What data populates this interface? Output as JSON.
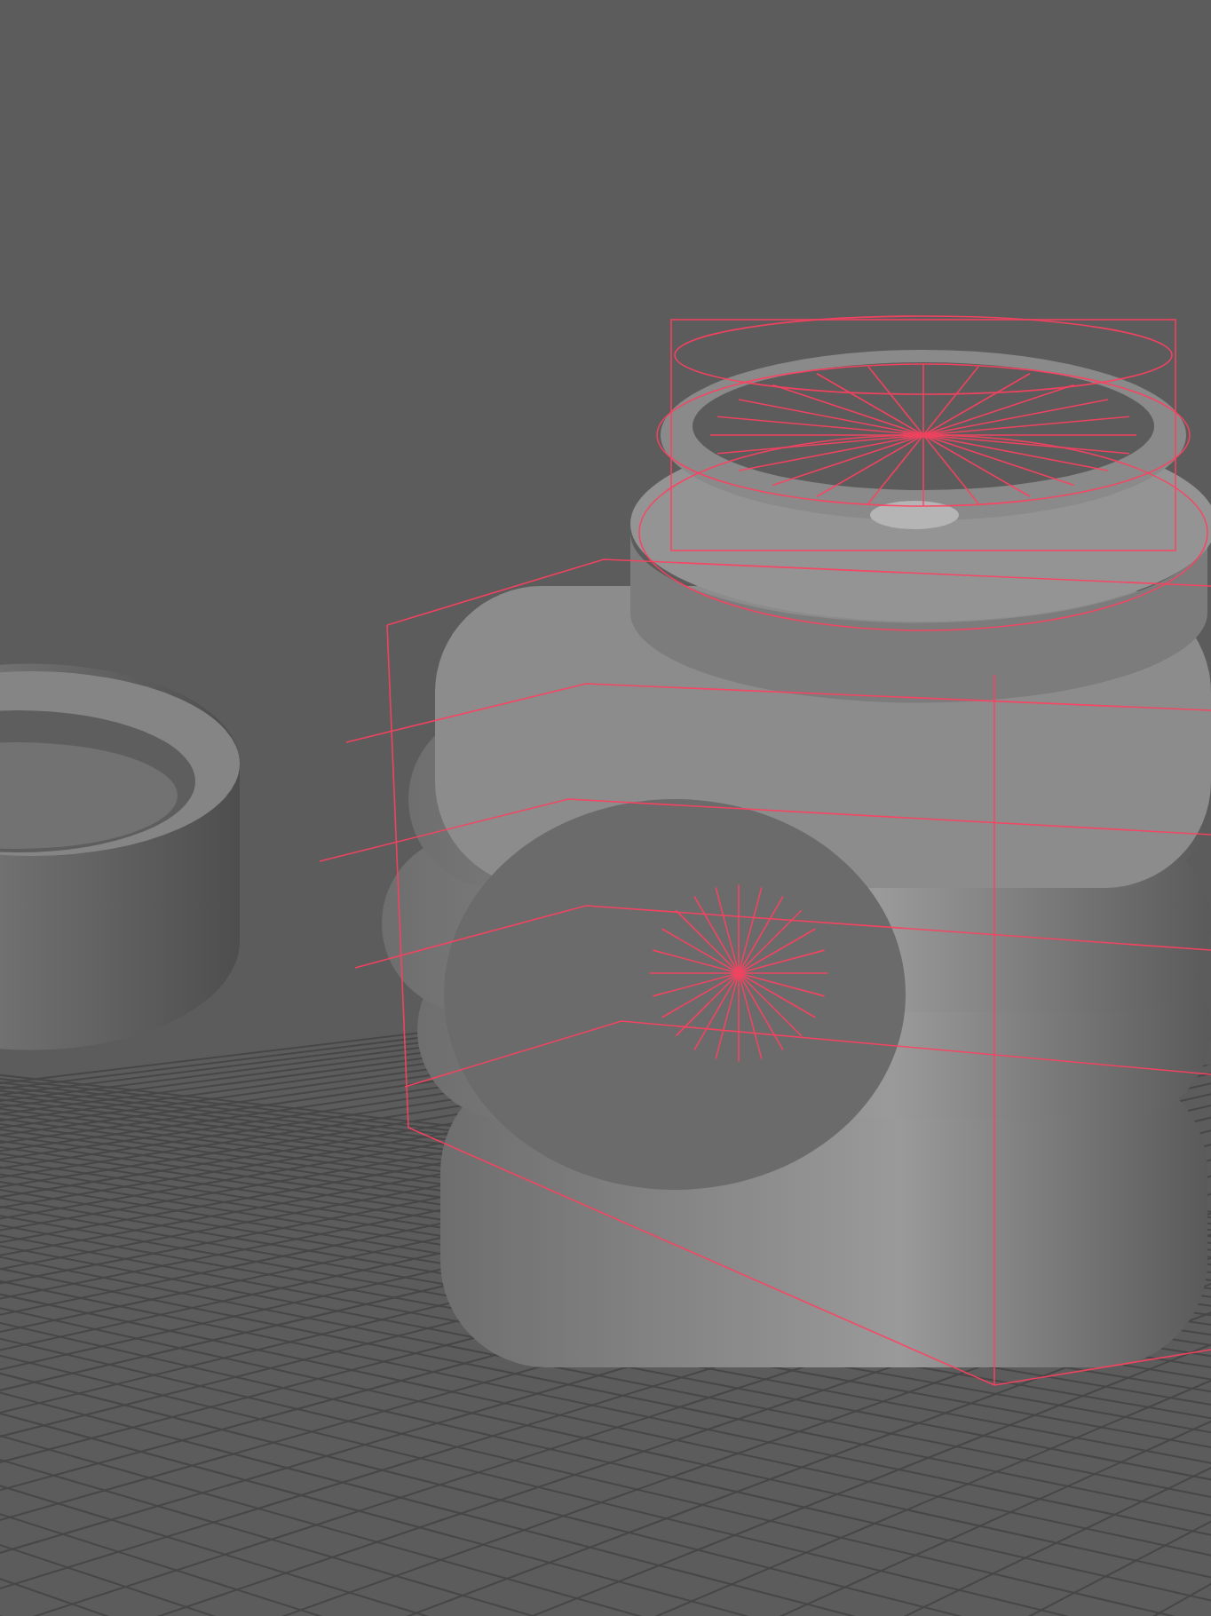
{
  "viewport": {
    "grid": true,
    "wireframe": true
  }
}
